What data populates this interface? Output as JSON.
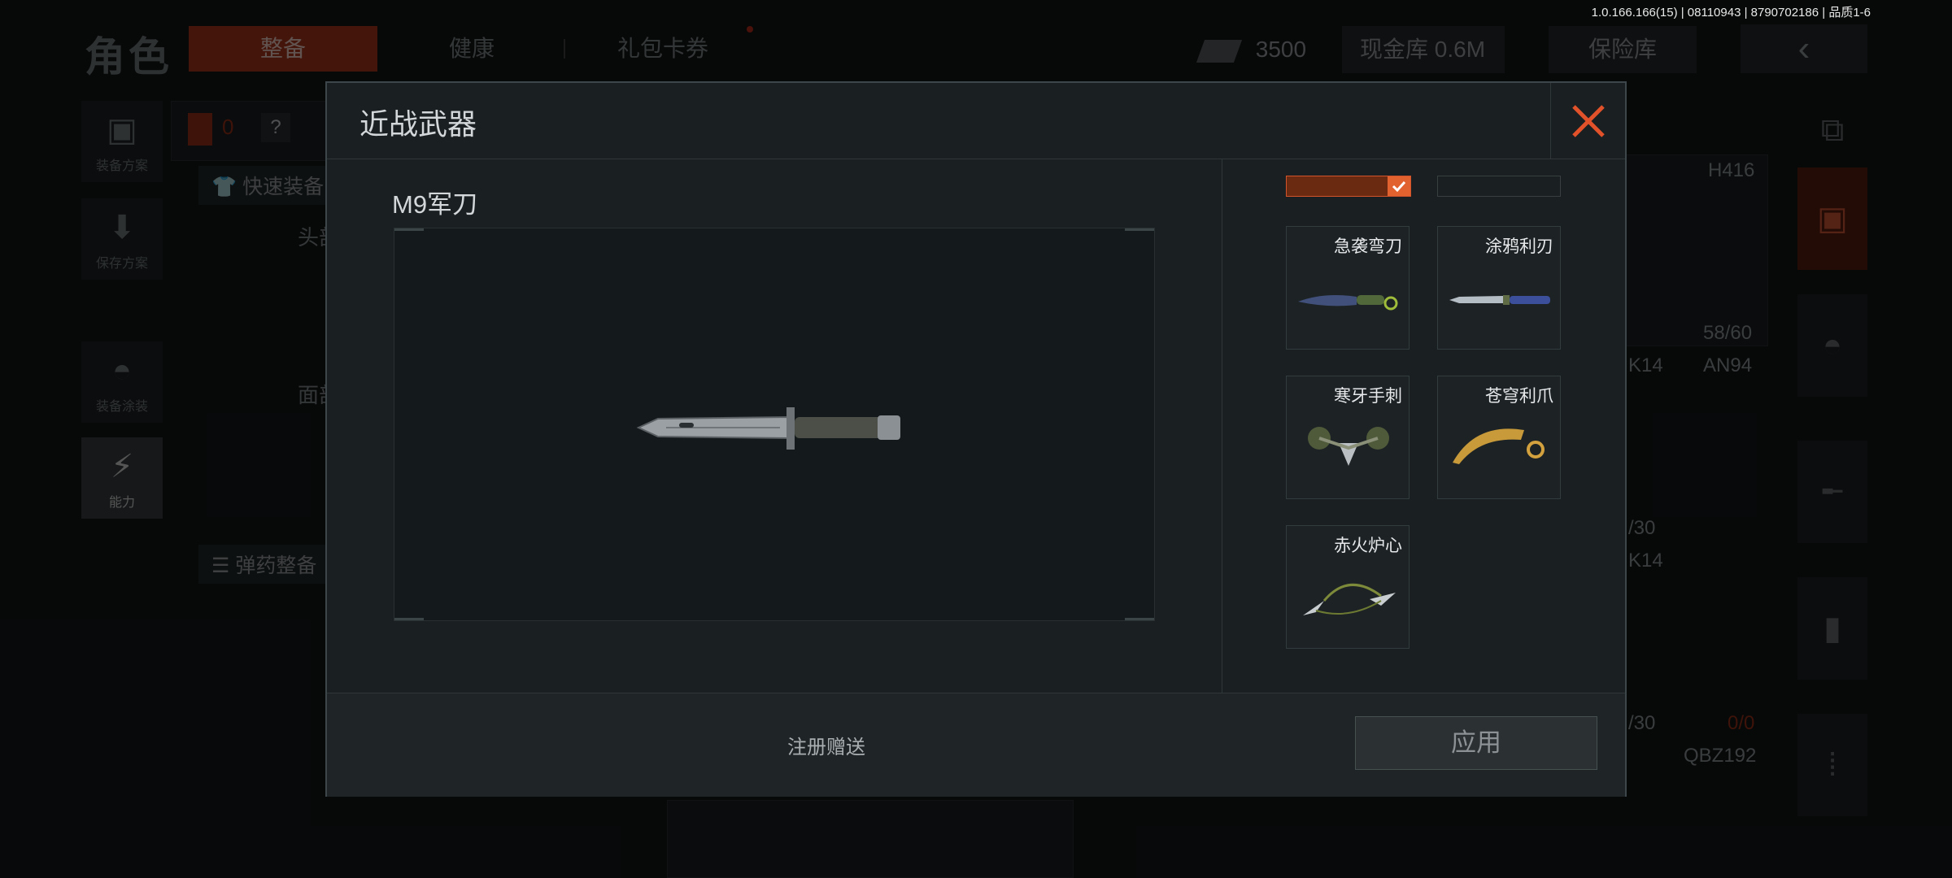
{
  "version_text": "1.0.166.166(15) | 08110943 | 8790702186 | 品质1-6",
  "header": {
    "title": "角色",
    "tabs": [
      {
        "label": "整备",
        "active": true
      },
      {
        "label": "健康",
        "active": false
      },
      {
        "label": "礼包卡券",
        "active": false
      }
    ],
    "cash": "3500",
    "vault": "现金库 0.6M",
    "insurance": "保险库",
    "back_icon": "chevron-left-icon"
  },
  "left_nav": [
    {
      "label": "装备方案",
      "icon": "backpack-icon"
    },
    {
      "label": "保存方案",
      "icon": "download-icon"
    },
    {
      "label": "装备涂装",
      "icon": "helmet-icon"
    },
    {
      "label": "能力",
      "icon": "lightning-hex-icon"
    }
  ],
  "loadout": {
    "counter": "0",
    "help_icon": "?",
    "quick_equip": "快速装备",
    "head_label": "头部",
    "face_label": "面部",
    "ammo_equip": "弹药整备",
    "weapons": [
      {
        "name": "H416",
        "ammo": "58/60"
      },
      {
        "name": "K14",
        "ammo": "/30"
      },
      {
        "name": "AN94",
        "ammo": ""
      },
      {
        "name": "K14",
        "ammo": "/30"
      },
      {
        "name": "",
        "ammo": "0/0"
      },
      {
        "name": "QBZ192",
        "ammo": ""
      }
    ]
  },
  "modal": {
    "title": "近战武器",
    "weapon_name": "M9军刀",
    "footer_note": "注册赠送",
    "apply_label": "应用",
    "close_icon": "close-icon",
    "skins": [
      {
        "name": "急袭弯刀",
        "icon": "karambit-blue-icon"
      },
      {
        "name": "涂鸦利刃",
        "icon": "graffiti-blade-icon"
      },
      {
        "name": "寒牙手刺",
        "icon": "claw-spike-icon"
      },
      {
        "name": "苍穹利爪",
        "icon": "gold-claw-icon"
      },
      {
        "name": "赤火炉心",
        "icon": "chain-dart-icon"
      }
    ],
    "colors": {
      "accent": "#e2622f",
      "close": "#e2522a"
    }
  }
}
